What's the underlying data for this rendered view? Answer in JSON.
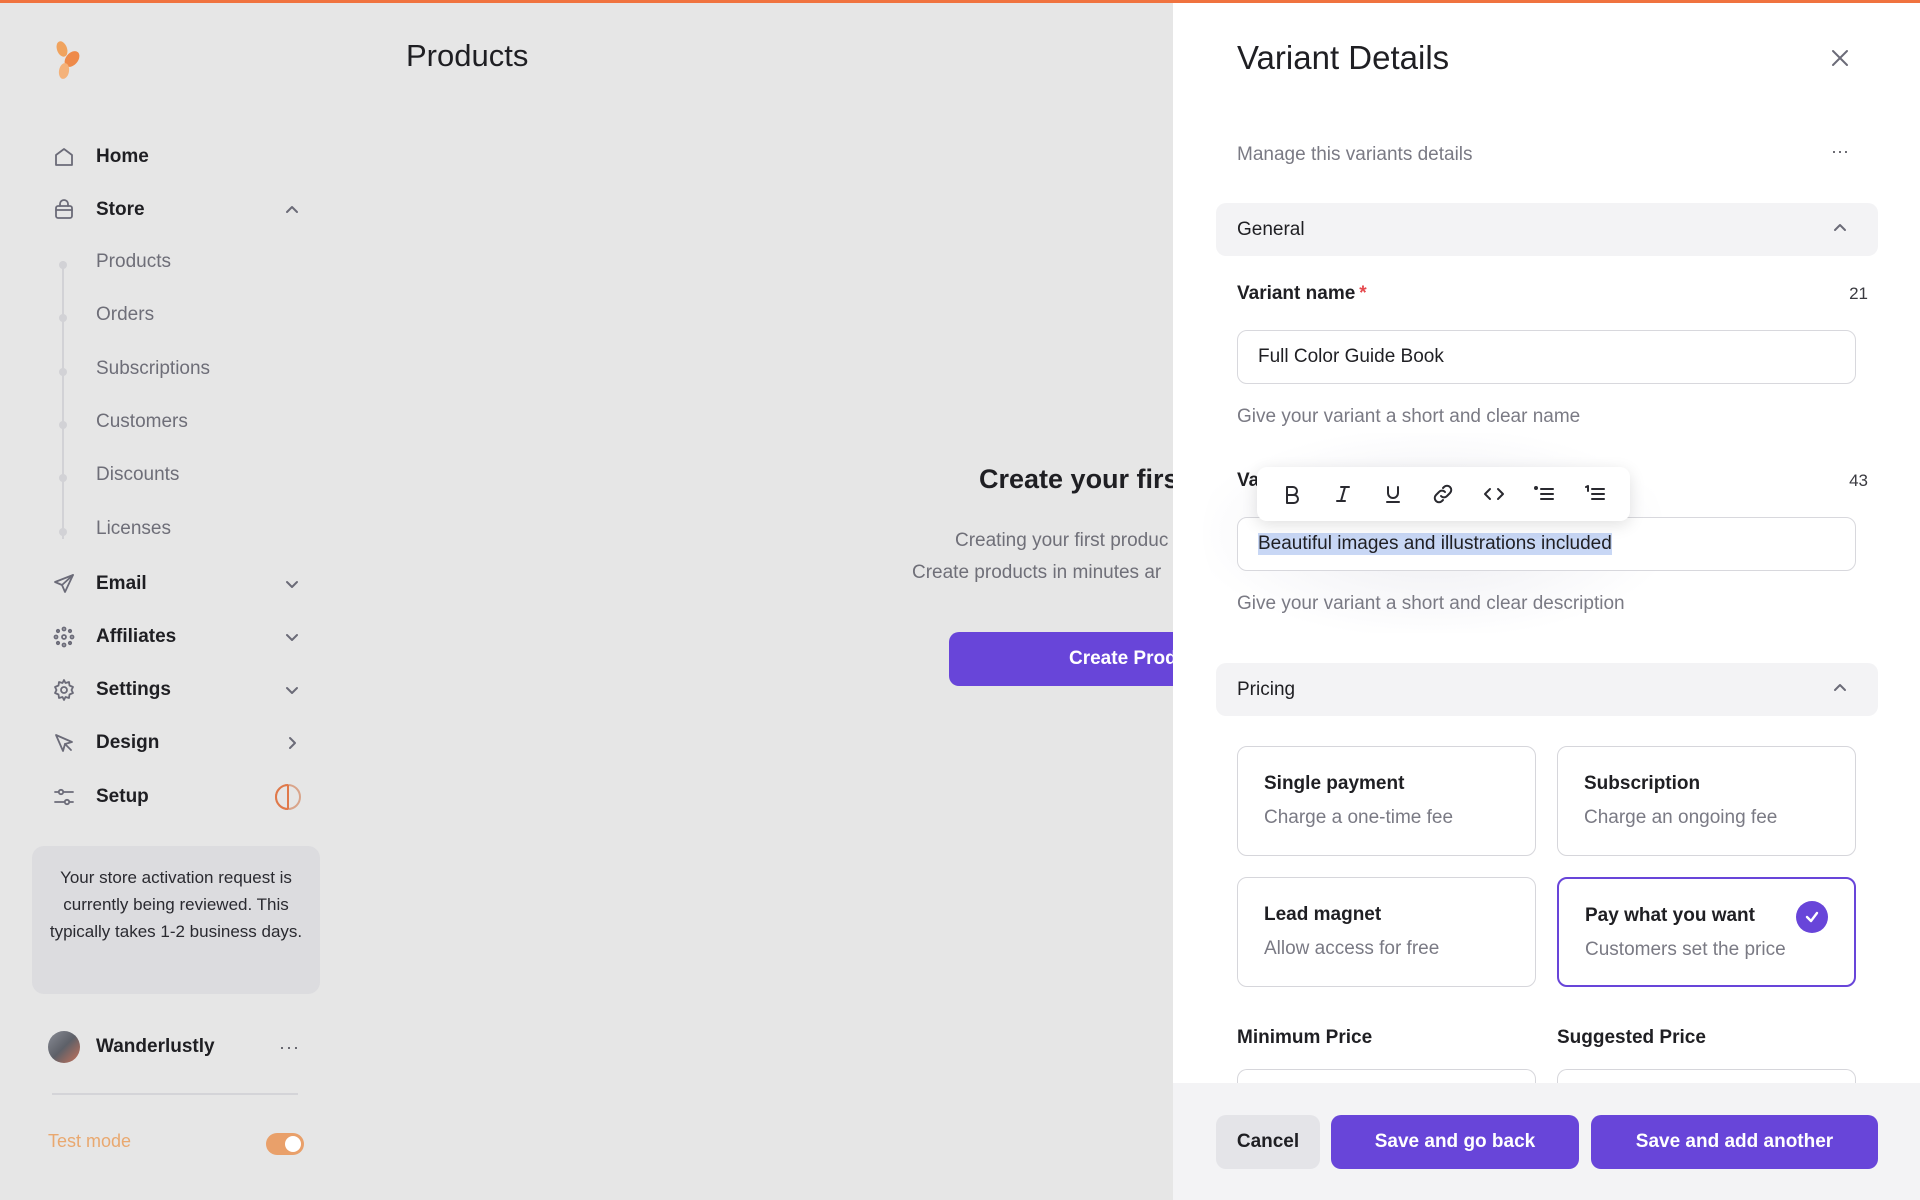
{
  "colors": {
    "accent": "#6845d9",
    "brand": "#f0733f",
    "test_mode": "#e9a86f"
  },
  "sidebar": {
    "nav": {
      "home": "Home",
      "store": "Store",
      "email": "Email",
      "affiliates": "Affiliates",
      "settings": "Settings",
      "design": "Design",
      "setup": "Setup"
    },
    "store_items": [
      "Products",
      "Orders",
      "Subscriptions",
      "Customers",
      "Discounts",
      "Licenses"
    ],
    "notice": "Your store activation request is currently being reviewed. This typically takes 1-2 business days.",
    "user": {
      "name": "Wanderlustly",
      "more": "···"
    },
    "test_mode": {
      "label": "Test mode",
      "enabled": true
    }
  },
  "main": {
    "title": "Products",
    "empty_state": {
      "heading": "Create your firs",
      "line1": "Creating your first produc",
      "line2": "Create products in minutes ar",
      "button": "Create Prod"
    }
  },
  "panel": {
    "title": "Variant Details",
    "subtitle": "Manage this variants details",
    "more": "···",
    "general": {
      "title": "General",
      "variant_name": {
        "label": "Variant name",
        "required": "*",
        "count": "21",
        "value": "Full Color Guide Book",
        "hint": "Give your variant a short and clear name"
      },
      "variant_description": {
        "label_visible": "Va",
        "count": "43",
        "value": "Beautiful images and illustrations included",
        "hint": "Give your variant a short and clear description"
      }
    },
    "pricing": {
      "title": "Pricing",
      "options": [
        {
          "title": "Single payment",
          "desc": "Charge a one-time fee"
        },
        {
          "title": "Subscription",
          "desc": "Charge an ongoing fee"
        },
        {
          "title": "Lead magnet",
          "desc": "Allow access for free"
        },
        {
          "title": "Pay what you want",
          "desc": "Customers set the price"
        }
      ],
      "selected": "Pay what you want",
      "minimum_price": "Minimum Price",
      "suggested_price": "Suggested Price"
    },
    "footer": {
      "cancel": "Cancel",
      "save_back": "Save and go back",
      "save_another": "Save and add another"
    }
  },
  "icons": [
    "logo-icon",
    "home-icon",
    "bag-icon",
    "send-icon",
    "affiliates-icon",
    "gear-icon",
    "cursor-icon",
    "sliders-icon",
    "progress-ring-icon",
    "close-icon",
    "bold-icon",
    "italic-icon",
    "underline-icon",
    "link-icon",
    "code-icon",
    "bullet-list-icon",
    "numbered-list-icon",
    "check-icon"
  ]
}
